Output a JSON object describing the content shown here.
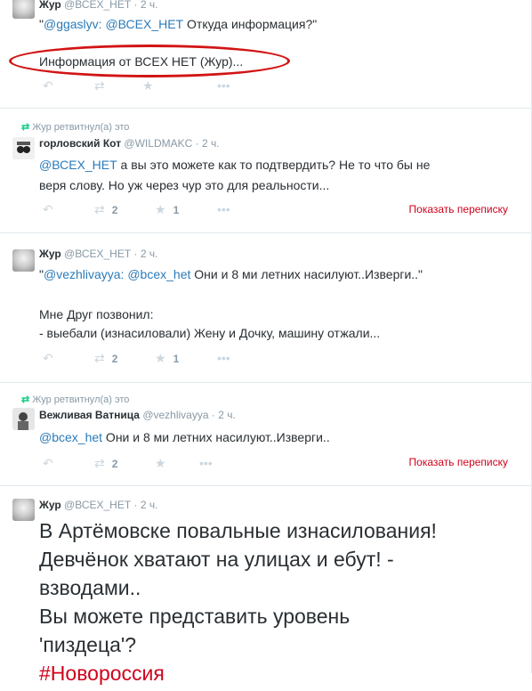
{
  "t1": {
    "name": "Жур",
    "screen_name": "@ВСЕХ_НЕТ",
    "time": "2 ч.",
    "quote_open": "\"",
    "mention1": "@ggaslyv:",
    "mention2": "@ВСЕХ_НЕТ",
    "text": " Откуда информация?\"",
    "line2": "Информация от ВСЕХ НЕТ (Жур)..."
  },
  "t2": {
    "retweet_label": "Жур ретвитнул(а) это",
    "name": "горловский Кот",
    "screen_name": "@WILDMAKC",
    "time": "2 ч.",
    "mention": "@ВСЕХ_НЕТ",
    "text1": " а вы это можете как то подтвердить? Не то что бы не",
    "text2": "веря слову. Но уж через чур это для реальности...",
    "retweets": "2",
    "favorites": "1",
    "conversation": "Показать переписку"
  },
  "t3": {
    "name": "Жур",
    "screen_name": "@ВСЕХ_НЕТ",
    "time": "2 ч.",
    "quote_open": "\"",
    "mention1": "@vezhlivayya:",
    "mention2": "@bcex_het",
    "text": " Они и 8 ми летних насилуют..Изверги..\"",
    "line2": "Мне Друг позвонил:",
    "line3": "- выебали (изнасиловали) Жену и Дочку, машину отжали...",
    "retweets": "2",
    "favorites": "1"
  },
  "t4": {
    "retweet_label": "Жур ретвитнул(а) это",
    "name": "Вежливая Ватница",
    "screen_name": "@vezhlivayya",
    "time": "2 ч.",
    "mention": "@bcex_het",
    "text": " Они и 8 ми летних насилуют..Изверги..",
    "retweets": "2",
    "conversation": "Показать переписку"
  },
  "t5": {
    "name": "Жур",
    "screen_name": "@ВСЕХ_НЕТ",
    "time": "2 ч.",
    "line1": "В Артёмовске повальные изнасилования!",
    "line2": "Девчёнок хватают на улицах и ебут! -",
    "line3": "взводами..",
    "line4": "Вы можете представить уровень",
    "line5": "'пиздеца'?",
    "hashtag": "#Новороссия"
  },
  "icons": {
    "reply": "reply-icon",
    "retweet": "retweet-icon",
    "favorite": "favorite-icon",
    "more": "more-icon",
    "retweeted_by": "retweet-small-icon"
  },
  "colors": {
    "link": "#2b7bb9",
    "icon": "#ccd6dd",
    "conversation": "#d0021b",
    "annotation": "#d21414",
    "retweet_green": "#19cf86"
  }
}
